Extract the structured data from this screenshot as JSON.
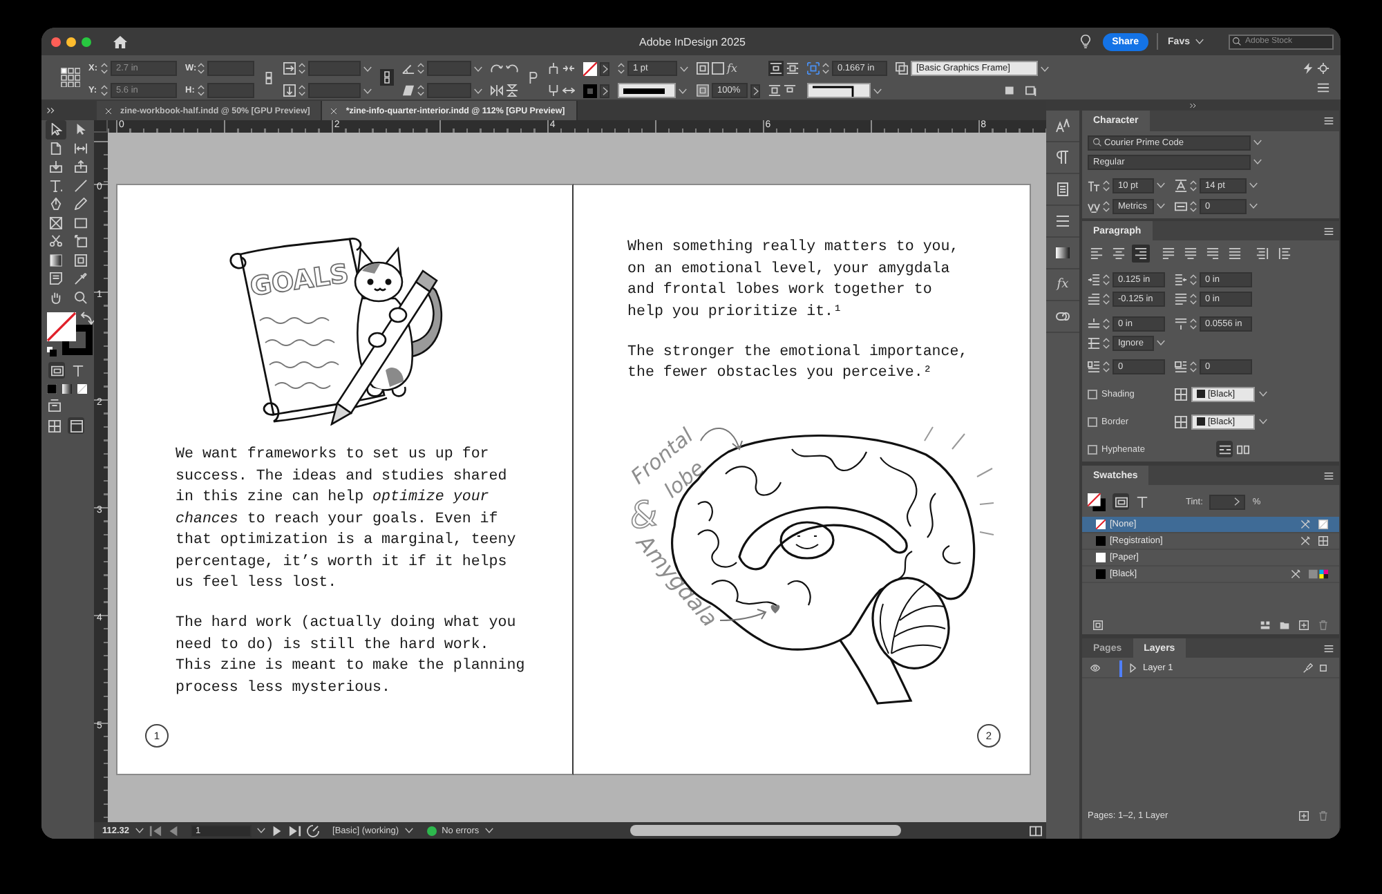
{
  "window": {
    "title": "Adobe InDesign 2025"
  },
  "title_bar": {
    "share_button": "Share",
    "favs_menu": "Favs",
    "search": {
      "placeholder": "Adobe Stock"
    }
  },
  "control_panel": {
    "position": [
      {
        "label": "X:",
        "value": "2.7 in"
      },
      {
        "label": "Y:",
        "value": "5.6 in"
      }
    ],
    "size": [
      {
        "label": "W:"
      },
      {
        "label": "H:"
      }
    ],
    "stroke_weight": "1 pt",
    "effects_glyph": "fx",
    "opacity": "100%",
    "wrap_offset": "0.1667 in",
    "object_style": "[Basic Graphics Frame]"
  },
  "doc_tabs": [
    {
      "label": "zine-workbook-half.indd @ 50% [GPU Preview]",
      "selected": false
    },
    {
      "label": "*zine-info-quarter-interior.indd @ 112% [GPU Preview]",
      "selected": true
    }
  ],
  "tools": [
    {
      "selected": true
    },
    {
      "selected": false
    },
    {
      "selected": false
    },
    {
      "selected": false
    },
    {
      "selected": false
    },
    {
      "selected": false
    },
    {
      "selected": false
    },
    {
      "selected": false
    },
    {
      "selected": false
    },
    {
      "selected": false
    },
    {
      "selected": false
    },
    {
      "selected": false
    },
    {
      "selected": false
    },
    {
      "selected": false
    },
    {
      "selected": false
    },
    {
      "selected": false
    },
    {
      "selected": false
    },
    {
      "selected": false
    },
    {
      "selected": false
    },
    {
      "selected": false
    }
  ],
  "rulers": {
    "horizontal": [
      "0",
      "2",
      "4",
      "6",
      "8"
    ],
    "vertical": [
      "0",
      "1",
      "2",
      "3",
      "4",
      "5"
    ]
  },
  "spread": {
    "pages": [
      {
        "kind": "cat-scroll",
        "illustration_text": [
          "GOALS"
        ],
        "paragraphs": [
          "We want frameworks to set us up for success. The ideas and studies shared in this zine can help *optimize your chances* to reach your goals. Even if that optimization is a marginal, teeny percentage, it’s worth it if it helps us feel less lost.",
          "The hard work (actually doing what you need to do) is still the hard work. This zine is meant to make the planning process less mysterious."
        ],
        "page_number": "1"
      },
      {
        "kind": "brain",
        "paragraphs": [
          "When something really matters to you, on an emotional level, your amygdala and frontal lobes work together to help you prioritize it.¹",
          "The stronger the emotional importance, the fewer obstacles you perceive.²"
        ],
        "illustration_text": [
          "Frontal",
          "lobe",
          "&",
          "Amygdala"
        ],
        "page_number": "2"
      }
    ]
  },
  "status_bar": {
    "zoom": "112.32",
    "page": "1",
    "preflight_profile": "[Basic] (working)",
    "preflight_status": "No errors"
  },
  "panel_dock": {
    "effects_glyph": "fx"
  },
  "character_panel": {
    "title": "Character",
    "font": "Courier Prime Code",
    "style": "Regular",
    "size": "10 pt",
    "leading": "14 pt",
    "kerning": "Metrics",
    "tracking": "0"
  },
  "paragraph_panel": {
    "title": "Paragraph",
    "alignment": [
      {
        "selected": false
      },
      {
        "selected": false
      },
      {
        "selected": true
      },
      {
        "selected": false
      },
      {
        "selected": false
      },
      {
        "selected": false
      },
      {
        "selected": false
      },
      {
        "selected": false
      },
      {
        "selected": false
      }
    ],
    "left_indent": "0.125 in",
    "right_indent": "0 in",
    "first_line_indent": "-0.125 in",
    "last_line_indent": "0 in",
    "space_before": "0 in",
    "space_after": "0.0556 in",
    "align_to_grid": "Ignore",
    "drop_cap_lines": "0",
    "drop_cap_characters": "0",
    "options": [
      {
        "label": "Shading",
        "checked": false,
        "swatch": "[Black]"
      },
      {
        "label": "Border",
        "checked": false,
        "swatch": "[Black]"
      },
      {
        "label": "Hyphenate",
        "checked": false
      }
    ]
  },
  "swatches_panel": {
    "title": "Swatches",
    "tint_label": "Tint:",
    "tint_unit": "%",
    "swatches": [
      {
        "name": "[None]",
        "kind": "none",
        "selected": true,
        "editable": false
      },
      {
        "name": "[Registration]",
        "kind": "registration",
        "color": "#000000",
        "selected": false,
        "editable": false
      },
      {
        "name": "[Paper]",
        "kind": "paper",
        "color": "#ffffff",
        "selected": false,
        "editable": true
      },
      {
        "name": "[Black]",
        "kind": "process",
        "color": "#000000",
        "selected": false,
        "editable": false
      }
    ]
  },
  "layers_panel": {
    "tabs": [
      {
        "label": "Pages",
        "selected": false
      },
      {
        "label": "Layers",
        "selected": true
      }
    ],
    "layers": [
      {
        "name": "Layer 1",
        "visible": true,
        "color": "#4f7fff"
      }
    ],
    "summary": "Pages: 1–2, 1 Layer"
  }
}
